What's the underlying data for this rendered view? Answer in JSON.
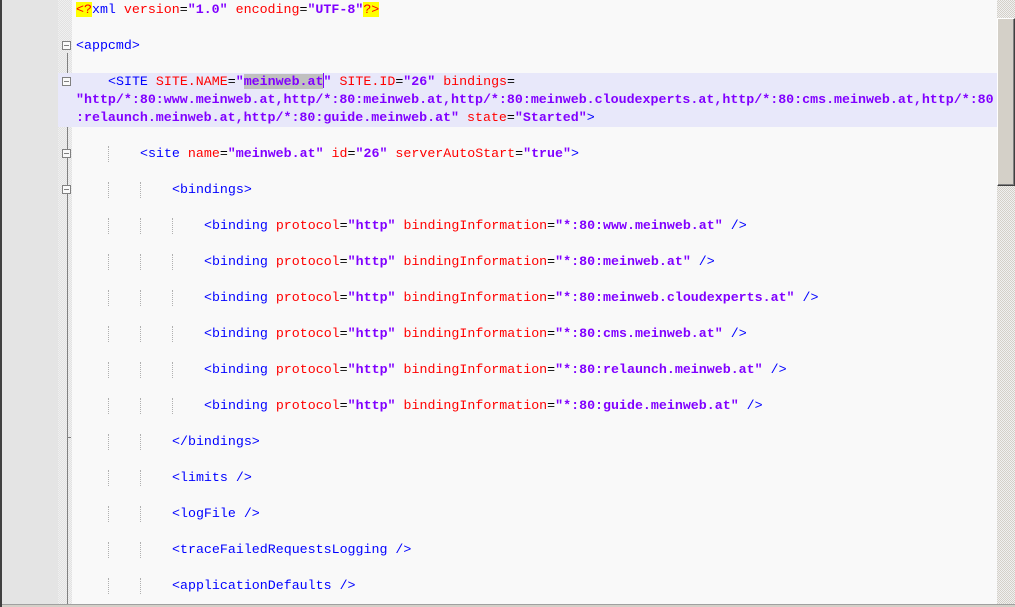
{
  "editor": {
    "current_line": 5,
    "scroll_fraction": 0.0,
    "lines": [
      {
        "n": "1",
        "indent": 0,
        "rows": [
          [
            [
              "pi",
              "<?"
            ],
            [
              "piname",
              "xml "
            ],
            [
              "attr",
              "version"
            ],
            [
              "eq",
              "="
            ],
            [
              "val",
              "\"1.0\""
            ],
            [
              "eq",
              " "
            ],
            [
              "attr",
              "encoding"
            ],
            [
              "eq",
              "="
            ],
            [
              "val",
              "\"UTF-8\""
            ],
            [
              "pi",
              "?>"
            ]
          ]
        ]
      },
      {
        "n": "2",
        "indent": 0,
        "rows": [
          []
        ]
      },
      {
        "n": "3",
        "indent": 0,
        "fold": "open",
        "rows": [
          [
            [
              "tag",
              "<appcmd>"
            ]
          ]
        ]
      },
      {
        "n": "4",
        "indent": 0,
        "rows": [
          []
        ]
      },
      {
        "n": "5",
        "indent": 4,
        "fold": "open",
        "rows": [
          [
            [
              "tag",
              "<SITE "
            ],
            [
              "attr",
              "SITE.NAME"
            ],
            [
              "eq",
              "="
            ],
            [
              "val",
              "\""
            ],
            [
              "sel",
              "meinweb.at"
            ],
            [
              "caret",
              ""
            ],
            [
              "val",
              "\""
            ],
            [
              "eq",
              " "
            ],
            [
              "attr",
              "SITE.ID"
            ],
            [
              "eq",
              "="
            ],
            [
              "val",
              "\"26\""
            ],
            [
              "eq",
              " "
            ],
            [
              "attr",
              "bindings"
            ],
            [
              "eq",
              "="
            ]
          ],
          [
            [
              "val",
              "\"http/*:80:www.meinweb.at,http/*:80:meinweb.at,http/*:80:meinweb.cloudexperts.at,http/*:80:cms.meinweb.at,http/*:80"
            ]
          ],
          [
            [
              "val",
              ":relaunch.meinweb.at,http/*:80:guide.meinweb.at\""
            ],
            [
              "eq",
              " "
            ],
            [
              "attr",
              "state"
            ],
            [
              "eq",
              "="
            ],
            [
              "val",
              "\"Started\""
            ],
            [
              "tag",
              ">"
            ]
          ]
        ]
      },
      {
        "n": "6",
        "indent": 0,
        "rows": [
          []
        ]
      },
      {
        "n": "7",
        "indent": 8,
        "fold": "open",
        "rows": [
          [
            [
              "tag",
              "<site "
            ],
            [
              "attr",
              "name"
            ],
            [
              "eq",
              "="
            ],
            [
              "val",
              "\"meinweb.at\""
            ],
            [
              "eq",
              " "
            ],
            [
              "attr",
              "id"
            ],
            [
              "eq",
              "="
            ],
            [
              "val",
              "\"26\""
            ],
            [
              "eq",
              " "
            ],
            [
              "attr",
              "serverAutoStart"
            ],
            [
              "eq",
              "="
            ],
            [
              "val",
              "\"true\""
            ],
            [
              "tag",
              ">"
            ]
          ]
        ]
      },
      {
        "n": "8",
        "indent": 0,
        "rows": [
          []
        ]
      },
      {
        "n": "9",
        "indent": 12,
        "fold": "open",
        "rows": [
          [
            [
              "tag",
              "<bindings>"
            ]
          ]
        ]
      },
      {
        "n": "10",
        "indent": 0,
        "rows": [
          []
        ]
      },
      {
        "n": "11",
        "indent": 16,
        "rows": [
          [
            [
              "tag",
              "<binding "
            ],
            [
              "attr",
              "protocol"
            ],
            [
              "eq",
              "="
            ],
            [
              "val",
              "\"http\""
            ],
            [
              "eq",
              " "
            ],
            [
              "attr",
              "bindingInformation"
            ],
            [
              "eq",
              "="
            ],
            [
              "val",
              "\"*:80:www.meinweb.at\""
            ],
            [
              "tag",
              " />"
            ]
          ]
        ]
      },
      {
        "n": "12",
        "indent": 0,
        "rows": [
          []
        ]
      },
      {
        "n": "13",
        "indent": 16,
        "rows": [
          [
            [
              "tag",
              "<binding "
            ],
            [
              "attr",
              "protocol"
            ],
            [
              "eq",
              "="
            ],
            [
              "val",
              "\"http\""
            ],
            [
              "eq",
              " "
            ],
            [
              "attr",
              "bindingInformation"
            ],
            [
              "eq",
              "="
            ],
            [
              "val",
              "\"*:80:meinweb.at\""
            ],
            [
              "tag",
              " />"
            ]
          ]
        ]
      },
      {
        "n": "14",
        "indent": 0,
        "rows": [
          []
        ]
      },
      {
        "n": "15",
        "indent": 16,
        "rows": [
          [
            [
              "tag",
              "<binding "
            ],
            [
              "attr",
              "protocol"
            ],
            [
              "eq",
              "="
            ],
            [
              "val",
              "\"http\""
            ],
            [
              "eq",
              " "
            ],
            [
              "attr",
              "bindingInformation"
            ],
            [
              "eq",
              "="
            ],
            [
              "val",
              "\"*:80:meinweb.cloudexperts.at\""
            ],
            [
              "tag",
              " />"
            ]
          ]
        ]
      },
      {
        "n": "16",
        "indent": 0,
        "rows": [
          []
        ]
      },
      {
        "n": "17",
        "indent": 16,
        "rows": [
          [
            [
              "tag",
              "<binding "
            ],
            [
              "attr",
              "protocol"
            ],
            [
              "eq",
              "="
            ],
            [
              "val",
              "\"http\""
            ],
            [
              "eq",
              " "
            ],
            [
              "attr",
              "bindingInformation"
            ],
            [
              "eq",
              "="
            ],
            [
              "val",
              "\"*:80:cms.meinweb.at\""
            ],
            [
              "tag",
              " />"
            ]
          ]
        ]
      },
      {
        "n": "18",
        "indent": 0,
        "rows": [
          []
        ]
      },
      {
        "n": "19",
        "indent": 16,
        "rows": [
          [
            [
              "tag",
              "<binding "
            ],
            [
              "attr",
              "protocol"
            ],
            [
              "eq",
              "="
            ],
            [
              "val",
              "\"http\""
            ],
            [
              "eq",
              " "
            ],
            [
              "attr",
              "bindingInformation"
            ],
            [
              "eq",
              "="
            ],
            [
              "val",
              "\"*:80:relaunch.meinweb.at\""
            ],
            [
              "tag",
              " />"
            ]
          ]
        ]
      },
      {
        "n": "20",
        "indent": 0,
        "rows": [
          []
        ]
      },
      {
        "n": "21",
        "indent": 16,
        "rows": [
          [
            [
              "tag",
              "<binding "
            ],
            [
              "attr",
              "protocol"
            ],
            [
              "eq",
              "="
            ],
            [
              "val",
              "\"http\""
            ],
            [
              "eq",
              " "
            ],
            [
              "attr",
              "bindingInformation"
            ],
            [
              "eq",
              "="
            ],
            [
              "val",
              "\"*:80:guide.meinweb.at\""
            ],
            [
              "tag",
              " />"
            ]
          ]
        ]
      },
      {
        "n": "22",
        "indent": 0,
        "rows": [
          []
        ]
      },
      {
        "n": "23",
        "indent": 12,
        "fold": "end",
        "rows": [
          [
            [
              "tag",
              "</bindings>"
            ]
          ]
        ]
      },
      {
        "n": "24",
        "indent": 0,
        "rows": [
          []
        ]
      },
      {
        "n": "25",
        "indent": 12,
        "rows": [
          [
            [
              "tag",
              "<limits />"
            ]
          ]
        ]
      },
      {
        "n": "26",
        "indent": 0,
        "rows": [
          []
        ]
      },
      {
        "n": "27",
        "indent": 12,
        "rows": [
          [
            [
              "tag",
              "<logFile />"
            ]
          ]
        ]
      },
      {
        "n": "28",
        "indent": 0,
        "rows": [
          []
        ]
      },
      {
        "n": "29",
        "indent": 12,
        "rows": [
          [
            [
              "tag",
              "<traceFailedRequestsLogging />"
            ]
          ]
        ]
      },
      {
        "n": "30",
        "indent": 0,
        "rows": [
          []
        ]
      },
      {
        "n": "31",
        "indent": 12,
        "rows": [
          [
            [
              "tag",
              "<applicationDefaults />"
            ]
          ]
        ]
      },
      {
        "n": "32",
        "indent": 0,
        "rows": [
          []
        ]
      }
    ]
  }
}
